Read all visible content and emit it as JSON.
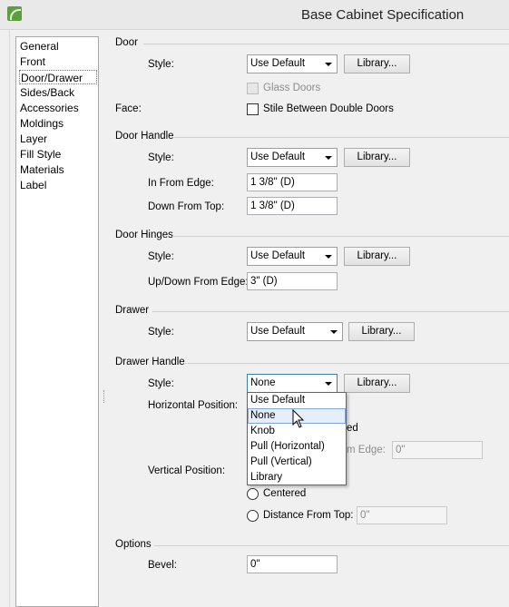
{
  "window": {
    "title": "Base Cabinet Specification",
    "icon": "app-logo-icon"
  },
  "sidebar": {
    "items": [
      {
        "label": "General"
      },
      {
        "label": "Front"
      },
      {
        "label": "Door/Drawer",
        "selected": true
      },
      {
        "label": "Sides/Back"
      },
      {
        "label": "Accessories"
      },
      {
        "label": "Moldings"
      },
      {
        "label": "Layer"
      },
      {
        "label": "Fill Style"
      },
      {
        "label": "Materials"
      },
      {
        "label": "Label"
      }
    ]
  },
  "door": {
    "section": "Door",
    "style_label": "Style:",
    "style_value": "Use Default",
    "library_label": "Library...",
    "glass_doors_label": "Glass Doors",
    "glass_doors_checked": false,
    "glass_doors_enabled": false,
    "face_label": "Face:",
    "stile_label": "Stile Between Double Doors",
    "stile_checked": false
  },
  "door_handle": {
    "section": "Door Handle",
    "style_label": "Style:",
    "style_value": "Use Default",
    "library_label": "Library...",
    "in_from_edge_label": "In From Edge:",
    "in_from_edge_value": "1 3/8\" (D)",
    "down_from_top_label": "Down From Top:",
    "down_from_top_value": "1 3/8\" (D)"
  },
  "door_hinges": {
    "section": "Door Hinges",
    "style_label": "Style:",
    "style_value": "Use Default",
    "library_label": "Library...",
    "updown_label": "Up/Down From Edge:",
    "updown_value": "3\" (D)"
  },
  "drawer": {
    "section": "Drawer",
    "style_label": "Style:",
    "style_value": "Use Default",
    "library_label": "Library..."
  },
  "drawer_handle": {
    "section": "Drawer Handle",
    "style_label": "Style:",
    "style_value": "None",
    "library_label": "Library...",
    "horizontal_label": "Horizontal Position:",
    "partial_ed": "ed",
    "partial_from_edge": "m Edge:",
    "from_edge_value": "0\"",
    "vertical_label": "Vertical Position:",
    "centered_label": "Centered",
    "distance_label": "Distance From Top:",
    "distance_value": "0\"",
    "dropdown_options": [
      "Use Default",
      "None",
      "Knob",
      "Pull (Horizontal)",
      "Pull (Vertical)",
      "Library"
    ],
    "dropdown_hovered": "None"
  },
  "options": {
    "section": "Options",
    "bevel_label": "Bevel:",
    "bevel_value": "0\""
  }
}
